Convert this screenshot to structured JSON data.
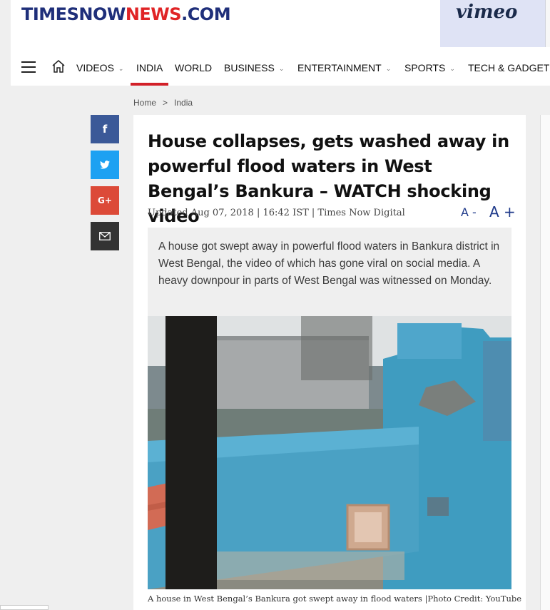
{
  "site": {
    "logo_part1": "TIMESNOW",
    "logo_part2": "NEWS",
    "logo_part3": ".COM",
    "ad_text": "vimeo"
  },
  "nav": {
    "items": [
      {
        "label": "VIDEOS",
        "has_dropdown": true
      },
      {
        "label": "INDIA",
        "active": true
      },
      {
        "label": "WORLD"
      },
      {
        "label": "BUSINESS",
        "has_dropdown": true
      },
      {
        "label": "ENTERTAINMENT",
        "has_dropdown": true
      },
      {
        "label": "SPORTS",
        "has_dropdown": true
      },
      {
        "label": "TECH & GADGETS"
      }
    ],
    "active_color": "#d22028"
  },
  "breadcrumb": {
    "home": "Home",
    "separator": ">",
    "current": "India"
  },
  "social": {
    "facebook": "f",
    "google_plus": "G+"
  },
  "article": {
    "headline": "House collapses, gets washed away in powerful flood waters in West Bengal’s Bankura – WATCH shocking video",
    "meta": "Updated Aug 07, 2018 | 16:42 IST | Times Now Digital",
    "font_decrease": "A -",
    "font_increase": "A +",
    "summary": "A house got swept away in powerful flood waters in Bankura district in West Bengal, the video of which has gone viral on social media. A heavy downpour in parts of West Bengal was witnessed on Monday.",
    "caption": "A house in West Bengal’s Bankura got swept away in flood waters |Photo Credit: YouTube"
  }
}
